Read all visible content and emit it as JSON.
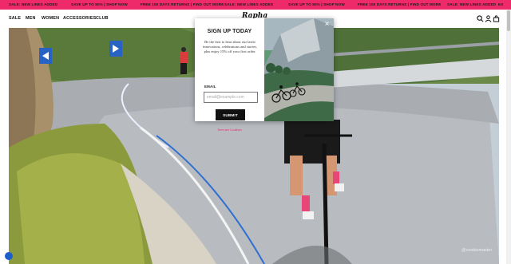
{
  "ticker": {
    "items": [
      "SALE: NEW LINES ADDED",
      "SAVE UP TO 50% | SHOP NOW",
      "FREE 100 DAYS RETURNS | FIND OUT MORE",
      "SALE: NEW LINES ADDED",
      "SAVE UP TO 50% | SHOP NOW",
      "FREE 100 DAYS RETURNS | FIND OUT MORE",
      "SALE: NEW LINES ADDED",
      "SAVE UP TO 50% | SHOP NOW",
      "FREE 100 DAYS RETURNS | FIND OUT MORE",
      "SALE: NEW LINES ADDED",
      "EX"
    ],
    "background": "#ee2a6b"
  },
  "header": {
    "nav": [
      "SALE",
      "MEN",
      "WOMEN",
      "ACCESSORIES",
      "CLUB"
    ],
    "logo": "Rapha",
    "icons": [
      "search-icon",
      "account-icon",
      "bag-icon"
    ]
  },
  "modal": {
    "title": "SIGN UP TODAY",
    "description": "Be the first to hear about our latest innovations, celebrations and stories, plus enjoy 15% off your first order.",
    "email_label": "EMAIL",
    "email_placeholder": "email@example.com",
    "email_value": "",
    "submit_label": "SUBMIT",
    "terms_label": "Terms and Conditions",
    "close_symbol": "×"
  },
  "watermark": "@cookiemaster",
  "colors": {
    "accent": "#ee2a6b",
    "button": "#111111"
  }
}
